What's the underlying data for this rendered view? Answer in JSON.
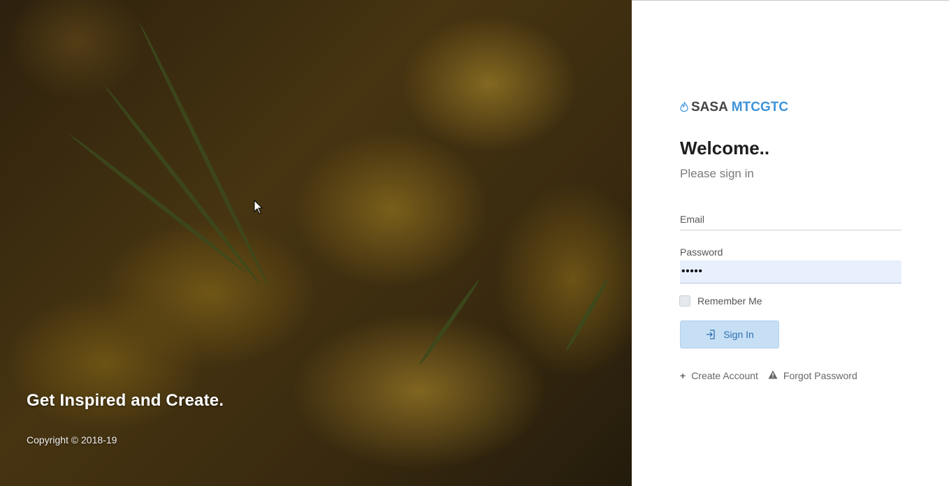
{
  "hero": {
    "tagline": "Get Inspired and Create.",
    "copyright": "Copyright © 2018-19"
  },
  "brand": {
    "icon": "flame-icon",
    "name_part1": "SASA",
    "name_part2": "MTCGTC",
    "accent_color": "#3e93d8"
  },
  "login": {
    "welcome": "Welcome..",
    "subtitle": "Please sign in",
    "email_label": "Email",
    "email_value": "",
    "password_label": "Password",
    "password_value": "•••••",
    "remember_label": "Remember Me",
    "remember_checked": false,
    "signin_label": "Sign In"
  },
  "links": {
    "create_account": "Create Account",
    "forgot_password": "Forgot Password"
  }
}
